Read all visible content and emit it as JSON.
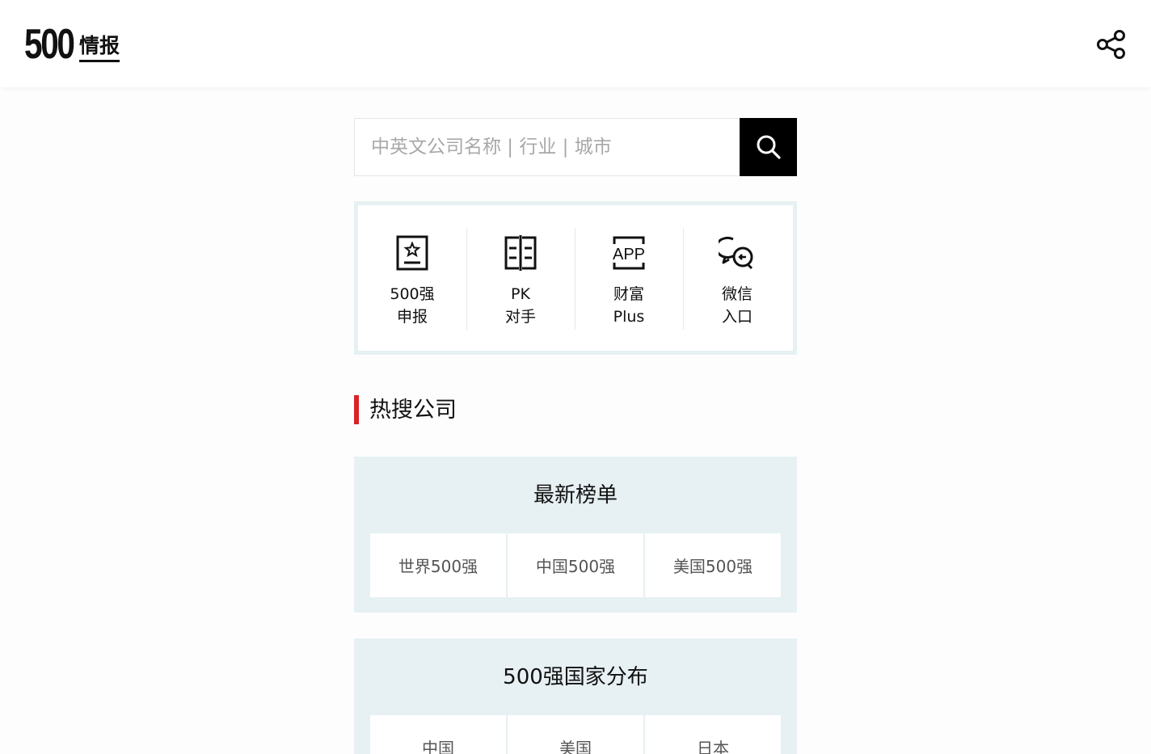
{
  "header": {
    "logo_number": "500",
    "logo_text": "情报",
    "share_icon": "share-icon"
  },
  "search": {
    "placeholder": "中英文公司名称 | 行业 | 城市",
    "value": "",
    "button_icon": "search-icon"
  },
  "quick_links": [
    {
      "label": "500强\n申报",
      "icon": "star-badge-icon"
    },
    {
      "label": "PK\n对手",
      "icon": "compare-icon"
    },
    {
      "label": "财富\nPlus",
      "icon": "app-icon"
    },
    {
      "label": "微信\n入口",
      "icon": "wechat-icon"
    }
  ],
  "hot_section": {
    "title": "热搜公司"
  },
  "cards": [
    {
      "title": "最新榜单",
      "links": [
        "世界500强",
        "中国500强",
        "美国500强"
      ]
    },
    {
      "title": "500强国家分布",
      "links": [
        "中国",
        "美国",
        "日本"
      ]
    }
  ],
  "colors": {
    "accent": "#d8232a",
    "card_bg": "#e7f0f3",
    "search_button": "#000000"
  }
}
